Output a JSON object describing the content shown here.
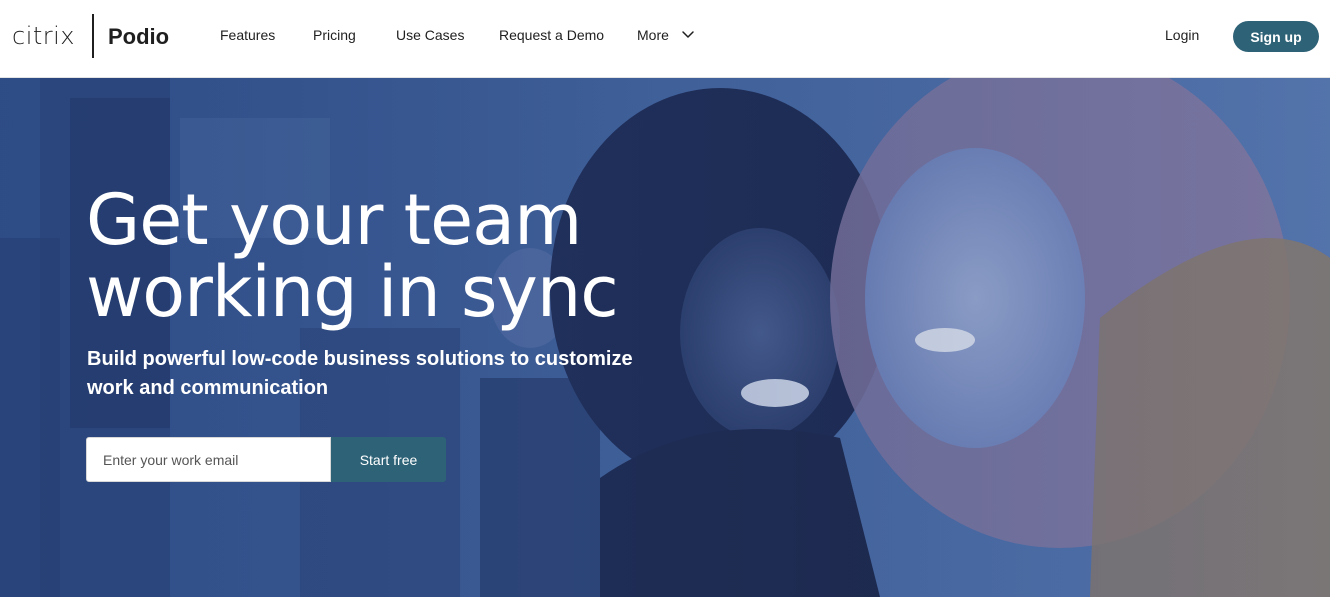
{
  "header": {
    "logo_brand": "citrix",
    "logo_product": "Podio",
    "nav": {
      "features": "Features",
      "pricing": "Pricing",
      "use_cases": "Use Cases",
      "request_demo": "Request a Demo",
      "more": "More"
    },
    "more_icon": "chevron-down-icon",
    "login": "Login",
    "signup": "Sign up"
  },
  "hero": {
    "title_line1": "Get your team",
    "title_line2": "working in sync",
    "subtitle_line1": "Build powerful low-code business solutions to customize",
    "subtitle_line2": "work and communication",
    "email_placeholder": "Enter your work email",
    "cta": "Start free"
  },
  "colors": {
    "accent": "#2e6277",
    "hero_overlay": "#3b5a8f",
    "text_dark": "#1f1f1f",
    "text_light": "#ffffff"
  }
}
